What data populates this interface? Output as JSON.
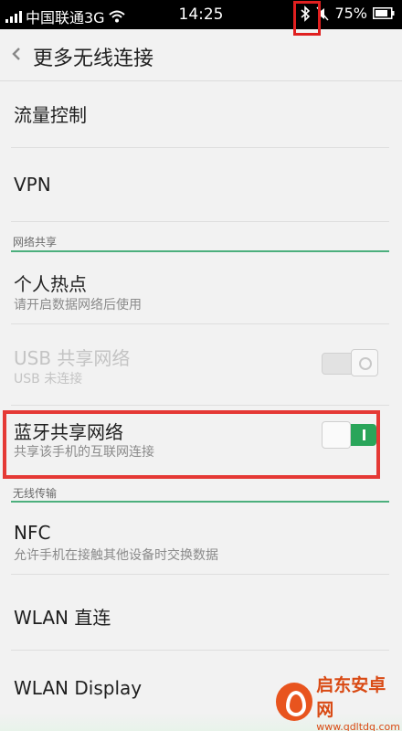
{
  "status_bar": {
    "carrier": "中国联通3G",
    "time": "14:25",
    "battery": "75%",
    "icons": [
      "signal-icon",
      "wifi-icon",
      "bluetooth-icon",
      "mute-icon",
      "battery-icon"
    ]
  },
  "header": {
    "back_icon": "chevron-left-icon",
    "title": "更多无线连接"
  },
  "items": {
    "data_usage": {
      "title": "流量控制"
    },
    "vpn": {
      "title": "VPN"
    },
    "hotspot": {
      "title": "个人热点",
      "subtitle": "请开启数据网络后使用"
    },
    "usb_tethering": {
      "title": "USB 共享网络",
      "subtitle": "USB 未连接",
      "switch_on": false,
      "disabled": true
    },
    "bt_tethering": {
      "title": "蓝牙共享网络",
      "subtitle": "共享该手机的互联网连接",
      "switch_on": true
    },
    "nfc": {
      "title": "NFC",
      "subtitle": "允许手机在接触其他设备时交换数据"
    },
    "wlan_direct": {
      "title": "WLAN 直连"
    },
    "wlan_display": {
      "title": "WLAN Display"
    }
  },
  "sections": {
    "tethering": "网络共享",
    "wireless_transfer": "无线传输"
  },
  "watermark": {
    "name": "启东安卓网",
    "url": "www.qdltdq.com"
  },
  "colors": {
    "accent_green": "#2aa55a",
    "section_line": "#4caf7d",
    "highlight_red": "#e53935"
  }
}
